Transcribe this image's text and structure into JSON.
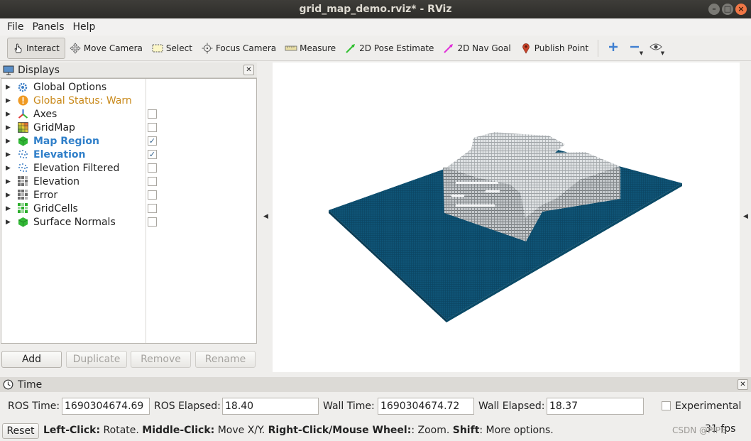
{
  "window": {
    "title": "grid_map_demo.rviz* - RViz"
  },
  "menu": {
    "items": [
      "File",
      "Panels",
      "Help"
    ]
  },
  "toolbar": {
    "tools": [
      {
        "label": "Interact",
        "icon": "hand-pointer-icon",
        "active": true
      },
      {
        "label": "Move Camera",
        "icon": "move-arrows-icon"
      },
      {
        "label": "Select",
        "icon": "selection-box-icon"
      },
      {
        "label": "Focus Camera",
        "icon": "focus-target-icon"
      },
      {
        "label": "Measure",
        "icon": "ruler-icon"
      },
      {
        "label": "2D Pose Estimate",
        "icon": "green-arrow-icon"
      },
      {
        "label": "2D Nav Goal",
        "icon": "magenta-arrow-icon"
      },
      {
        "label": "Publish Point",
        "icon": "map-pin-icon"
      }
    ],
    "extra": [
      "plus-icon",
      "minus-icon",
      "eye-icon"
    ]
  },
  "displays": {
    "title": "Displays",
    "items": [
      {
        "label": "Global Options",
        "icon": "gear-icon",
        "checkbox": null,
        "style": "normal"
      },
      {
        "label": "Global Status: Warn",
        "icon": "warning-icon",
        "checkbox": null,
        "style": "warn"
      },
      {
        "label": "Axes",
        "icon": "axes-icon",
        "checkbox": false,
        "style": "normal"
      },
      {
        "label": "GridMap",
        "icon": "gridmap-icon",
        "checkbox": false,
        "style": "normal"
      },
      {
        "label": "Map Region",
        "icon": "green-cube-icon",
        "checkbox": true,
        "style": "bold"
      },
      {
        "label": "Elevation",
        "icon": "pointcloud-icon",
        "checkbox": true,
        "style": "bold"
      },
      {
        "label": "Elevation Filtered",
        "icon": "pointcloud-icon",
        "checkbox": false,
        "style": "normal"
      },
      {
        "label": "Elevation",
        "icon": "gridcells-gray-icon",
        "checkbox": false,
        "style": "normal"
      },
      {
        "label": "Error",
        "icon": "gridcells-gray-icon",
        "checkbox": false,
        "style": "normal"
      },
      {
        "label": "GridCells",
        "icon": "gridcells-green-icon",
        "checkbox": false,
        "style": "normal"
      },
      {
        "label": "Surface Normals",
        "icon": "green-cube-icon",
        "checkbox": false,
        "style": "normal"
      }
    ],
    "buttons": {
      "add": "Add",
      "duplicate": "Duplicate",
      "remove": "Remove",
      "rename": "Rename"
    }
  },
  "time": {
    "title": "Time",
    "ros_time_label": "ROS Time:",
    "ros_time": "1690304674.69",
    "ros_elapsed_label": "ROS Elapsed:",
    "ros_elapsed": "18.40",
    "wall_time_label": "Wall Time:",
    "wall_time": "1690304674.72",
    "wall_elapsed_label": "Wall Elapsed:",
    "wall_elapsed": "18.37",
    "experimental_label": "Experimental"
  },
  "status": {
    "reset": "Reset",
    "hint_parts": [
      {
        "b": "Left-Click:",
        "t": " Rotate. "
      },
      {
        "b": "Middle-Click:",
        "t": " Move X/Y. "
      },
      {
        "b": "Right-Click/Mouse Wheel:",
        "t": ": Zoom. "
      },
      {
        "b": "Shift",
        "t": ": More options."
      }
    ],
    "fps": "31 fps",
    "watermark": "CSDN @PIPE"
  },
  "colors": {
    "ground": "#0f5476",
    "star": "#d9dcde",
    "accent": "#2f7fc9",
    "warn": "#c98a1c"
  }
}
